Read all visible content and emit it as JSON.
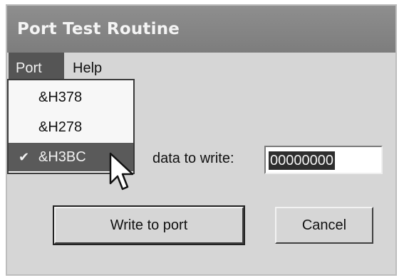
{
  "window": {
    "title": "Port Test Routine"
  },
  "menubar": {
    "items": [
      {
        "label": "Port"
      },
      {
        "label": "Help"
      }
    ]
  },
  "port_menu": {
    "items": [
      {
        "label": "&H378",
        "checked": false
      },
      {
        "label": "&H278",
        "checked": false
      },
      {
        "label": "&H3BC",
        "checked": true
      }
    ],
    "check_glyph": "✔"
  },
  "form": {
    "data_label": "data to write:",
    "data_value": "00000000"
  },
  "buttons": {
    "write_label": "Write to port",
    "cancel_label": "Cancel"
  },
  "icons": {
    "cursor": "mouse-pointer-icon",
    "check": "checkmark-icon"
  }
}
